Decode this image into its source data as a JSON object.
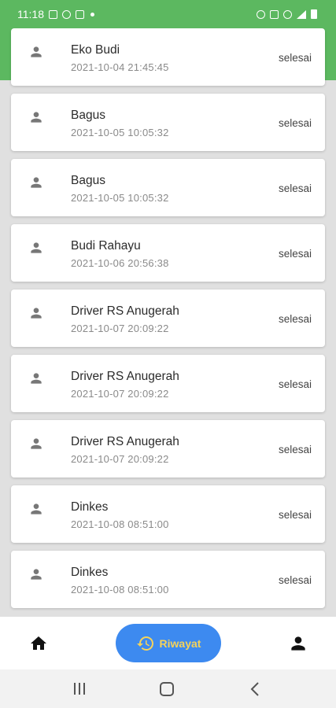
{
  "status_bar": {
    "time": "11:18",
    "icons_left": [
      "image-icon",
      "whatsapp-icon",
      "instagram-icon",
      "dot-icon"
    ],
    "icons_right": [
      "alarm-icon",
      "mute-icon",
      "blocked-icon",
      "signal-icon",
      "battery-icon"
    ]
  },
  "history": {
    "items": [
      {
        "name": "Eko Budi",
        "datetime": "2021-10-04 21:45:45",
        "status": "selesai"
      },
      {
        "name": "Bagus",
        "datetime": "2021-10-05 10:05:32",
        "status": "selesai"
      },
      {
        "name": "Bagus",
        "datetime": "2021-10-05 10:05:32",
        "status": "selesai"
      },
      {
        "name": "Budi Rahayu",
        "datetime": "2021-10-06 20:56:38",
        "status": "selesai"
      },
      {
        "name": "Driver RS Anugerah",
        "datetime": "2021-10-07 20:09:22",
        "status": "selesai"
      },
      {
        "name": "Driver RS Anugerah",
        "datetime": "2021-10-07 20:09:22",
        "status": "selesai"
      },
      {
        "name": "Driver RS Anugerah",
        "datetime": "2021-10-07 20:09:22",
        "status": "selesai"
      },
      {
        "name": "Dinkes",
        "datetime": "2021-10-08 08:51:00",
        "status": "selesai"
      },
      {
        "name": "Dinkes",
        "datetime": "2021-10-08 08:51:00",
        "status": "selesai"
      }
    ]
  },
  "bottom_nav": {
    "riwayat_label": "Riwayat",
    "items": [
      "home-icon",
      "history-icon",
      "person-icon"
    ]
  },
  "colors": {
    "header_green": "#5cb860",
    "accent_blue": "#3d8af0",
    "label_yellow": "#f6d35a"
  }
}
